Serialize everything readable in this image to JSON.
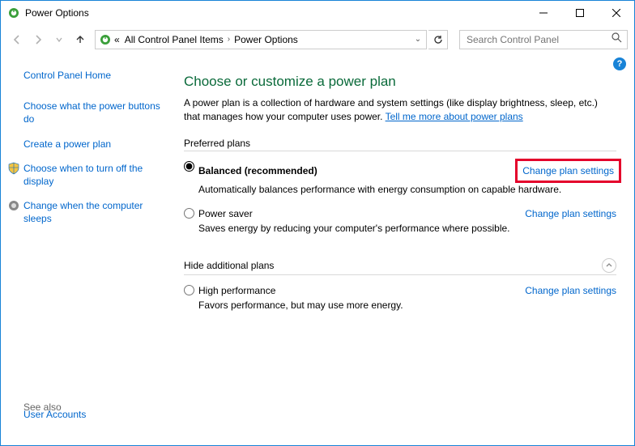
{
  "window": {
    "title": "Power Options"
  },
  "breadcrumb": {
    "root": "«",
    "level1": "All Control Panel Items",
    "level2": "Power Options"
  },
  "search": {
    "placeholder": "Search Control Panel"
  },
  "sidebar": {
    "home": "Control Panel Home",
    "links": [
      "Choose what the power buttons do",
      "Create a power plan",
      "Choose when to turn off the display",
      "Change when the computer sleeps"
    ],
    "seealso_label": "See also",
    "bottom": "User Accounts"
  },
  "main": {
    "heading": "Choose or customize a power plan",
    "intro_a": "A power plan is a collection of hardware and system settings (like display brightness, sleep, etc.) that manages how your computer uses power. ",
    "intro_link": "Tell me more about power plans",
    "group1": "Preferred plans",
    "group2": "Hide additional plans",
    "change": "Change plan settings",
    "plans": {
      "balanced": {
        "name": "Balanced (recommended)",
        "desc": "Automatically balances performance with energy consumption on capable hardware."
      },
      "saver": {
        "name": "Power saver",
        "desc": "Saves energy by reducing your computer's performance where possible."
      },
      "high": {
        "name": "High performance",
        "desc": "Favors performance, but may use more energy."
      }
    }
  }
}
